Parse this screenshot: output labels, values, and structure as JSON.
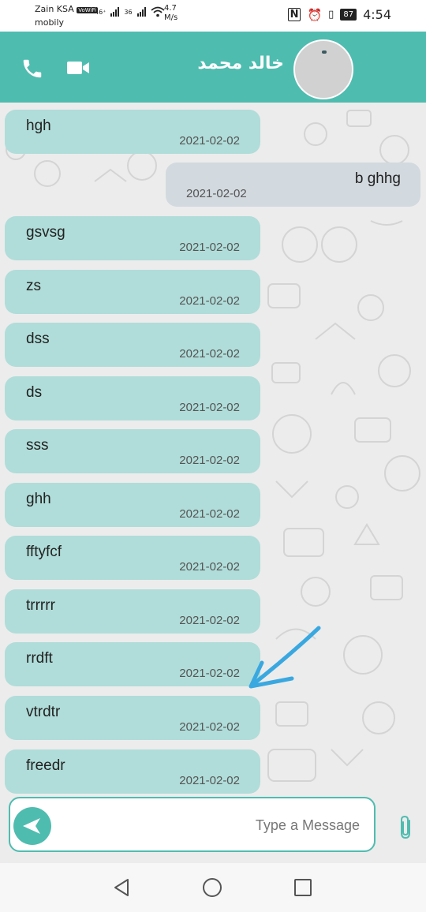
{
  "status_bar": {
    "carrier1": "Zain KSA",
    "volte": "VoWiFi",
    "carrier2": "mobily",
    "net1": "46⁺",
    "net2": "36",
    "speed_value": "4.7",
    "speed_unit": "M/s",
    "battery": "87",
    "time": "4:54"
  },
  "header": {
    "contact_name": "خالد محمد",
    "icons": [
      "phone-icon",
      "video-camera-icon"
    ]
  },
  "messages": [
    {
      "text": "hgh",
      "time": "2021-02-02",
      "direction": "in"
    },
    {
      "text": "b ghhg",
      "time": "2021-02-02",
      "direction": "out"
    },
    {
      "text": "gsvsg",
      "time": "2021-02-02",
      "direction": "in"
    },
    {
      "text": "zs",
      "time": "2021-02-02",
      "direction": "in"
    },
    {
      "text": "dss",
      "time": "2021-02-02",
      "direction": "in"
    },
    {
      "text": "ds",
      "time": "2021-02-02",
      "direction": "in"
    },
    {
      "text": "sss",
      "time": "2021-02-02",
      "direction": "in"
    },
    {
      "text": "ghh",
      "time": "2021-02-02",
      "direction": "in"
    },
    {
      "text": "fftyfcf",
      "time": "2021-02-02",
      "direction": "in"
    },
    {
      "text": "trrrrr",
      "time": "2021-02-02",
      "direction": "in"
    },
    {
      "text": "rrdft",
      "time": "2021-02-02",
      "direction": "in"
    },
    {
      "text": "vtrdtr",
      "time": "2021-02-02",
      "direction": "in"
    },
    {
      "text": "freedr",
      "time": "2021-02-02",
      "direction": "in"
    }
  ],
  "composer": {
    "placeholder": "Type a Message"
  },
  "colors": {
    "accent": "#4fbcb0",
    "incoming_bubble": "#b0ddd9",
    "outgoing_bubble": "#d2d9df",
    "annotation_arrow": "#3aa8e0"
  }
}
